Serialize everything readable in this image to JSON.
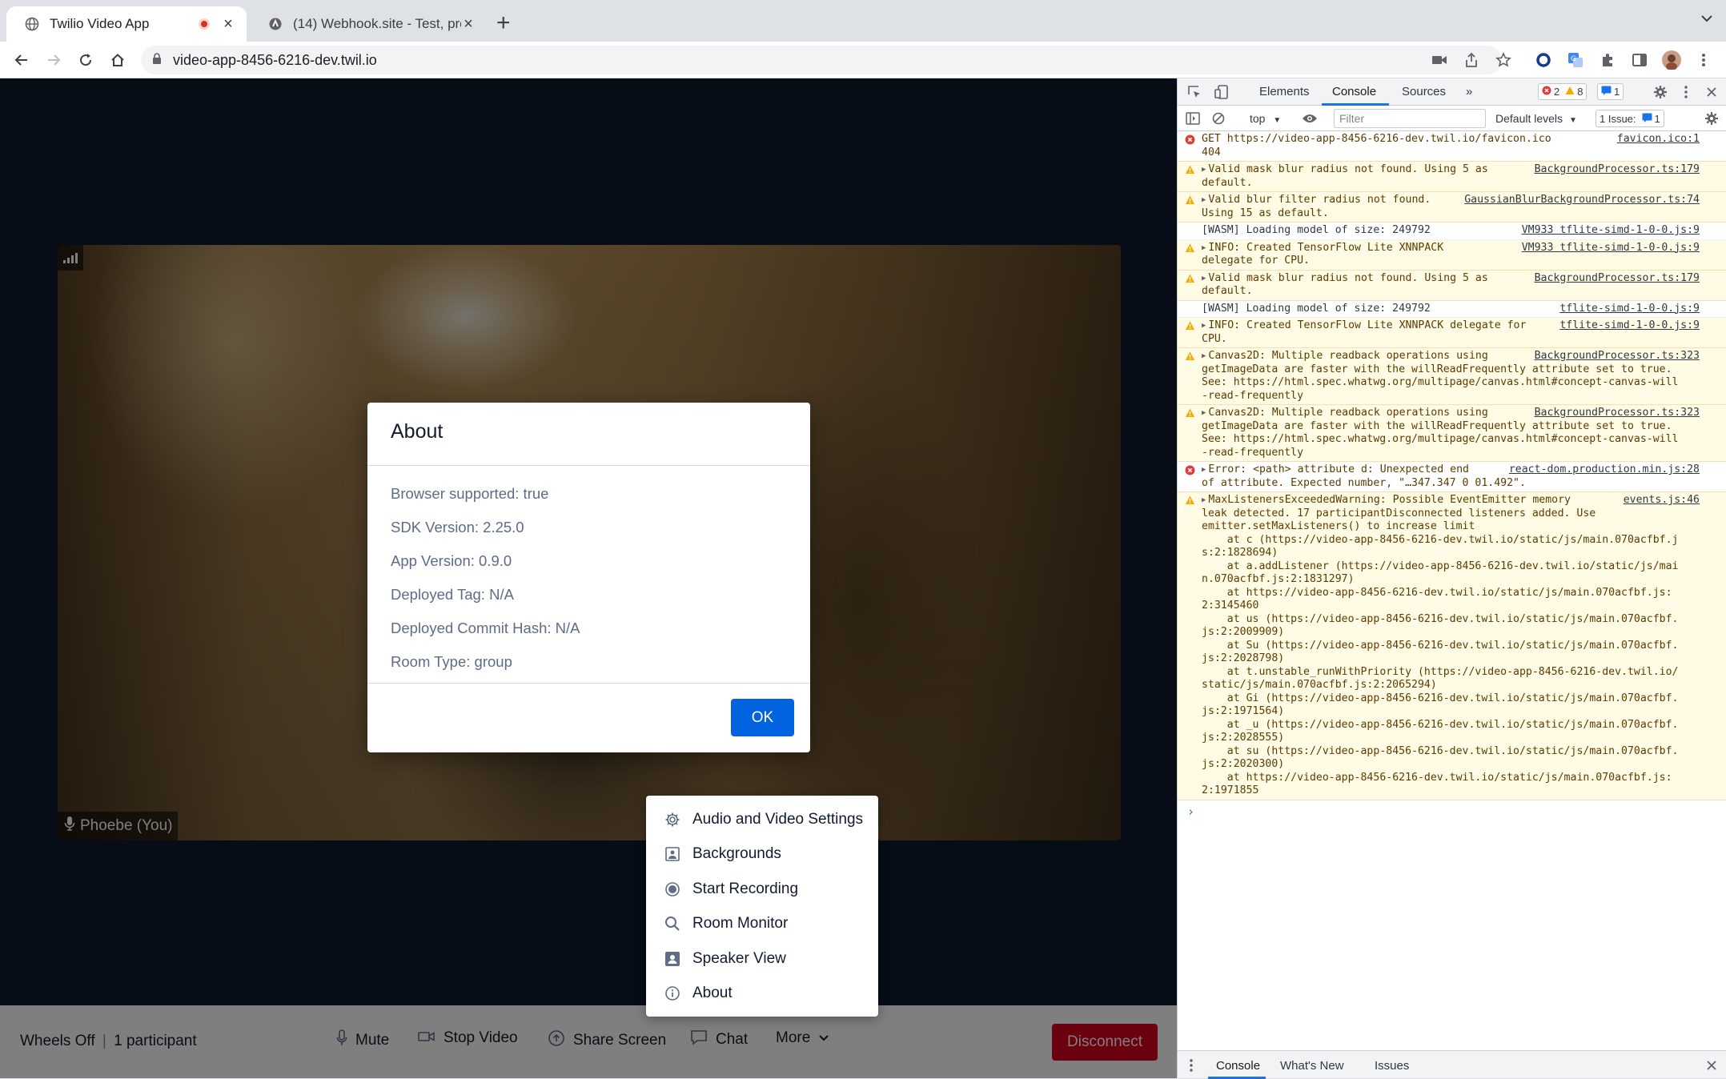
{
  "browser": {
    "tabs": [
      {
        "title": "Twilio Video App",
        "active": true,
        "recording": true
      },
      {
        "title": "(14) Webhook.site - Test, proc",
        "active": false
      }
    ],
    "url": "video-app-8456-6216-dev.twil.io"
  },
  "video": {
    "participant_label": "Phoebe (You)"
  },
  "menu_bar": {
    "room_name": "Wheels Off",
    "participant_count": "1 participant",
    "mute": "Mute",
    "stop_video": "Stop Video",
    "share_screen": "Share Screen",
    "chat": "Chat",
    "more": "More",
    "disconnect": "Disconnect",
    "disconnect_color": "#d6001c"
  },
  "more_menu": {
    "items": [
      {
        "label": "Audio and Video Settings",
        "icon": "gear-icon"
      },
      {
        "label": "Backgrounds",
        "icon": "image-icon"
      },
      {
        "label": "Start Recording",
        "icon": "record-icon"
      },
      {
        "label": "Room Monitor",
        "icon": "search-icon"
      },
      {
        "label": "Speaker View",
        "icon": "person-icon"
      },
      {
        "label": "About",
        "icon": "info-icon"
      }
    ]
  },
  "about_dialog": {
    "title": "About",
    "lines": [
      "Browser supported: true",
      "SDK Version: 2.25.0",
      "App Version: 0.9.0",
      "Deployed Tag: N/A",
      "Deployed Commit Hash: N/A",
      "Room Type: group"
    ],
    "ok": "OK",
    "ok_color": "#0263e0"
  },
  "devtools": {
    "tabs": [
      "Elements",
      "Console",
      "Sources"
    ],
    "active_tab": "Console",
    "error_count": "2",
    "warning_count": "8",
    "message_count": "1",
    "context": "top",
    "filter_placeholder": "Filter",
    "levels": "Default levels",
    "issues_label": "1 Issue:",
    "issues_count": "1",
    "drawer_tabs": [
      "Console",
      "What's New",
      "Issues"
    ],
    "console": [
      {
        "level": "error",
        "text": "GET https://video-app-8456-6216-dev.twil.io/favicon.ico\n404",
        "source": "favicon.ico:1"
      },
      {
        "level": "warn",
        "text": "Valid mask blur radius not found. Using 5 as\ndefault.",
        "source": "BackgroundProcessor.ts:179",
        "expand": true
      },
      {
        "level": "warn",
        "text": "Valid blur filter radius not found.\nUsing 15 as default.",
        "source": "GaussianBlurBackgroundProcessor.ts:74",
        "expand": true
      },
      {
        "level": "info",
        "text": "[WASM] Loading model of size: 249792",
        "source": "VM933 tflite-simd-1-0-0.js:9"
      },
      {
        "level": "warn",
        "text": "INFO: Created TensorFlow Lite XNNPACK\ndelegate for CPU.",
        "source": "VM933 tflite-simd-1-0-0.js:9",
        "expand": true
      },
      {
        "level": "warn",
        "text": "Valid mask blur radius not found. Using 5 as\ndefault.",
        "source": "BackgroundProcessor.ts:179",
        "expand": true
      },
      {
        "level": "info",
        "text": "[WASM] Loading model of size: 249792",
        "source": "tflite-simd-1-0-0.js:9"
      },
      {
        "level": "warn",
        "text": "INFO: Created TensorFlow Lite XNNPACK delegate for\nCPU.",
        "source": "tflite-simd-1-0-0.js:9",
        "expand": true
      },
      {
        "level": "warn",
        "text": "Canvas2D: Multiple readback operations using\ngetImageData are faster with the willReadFrequently attribute set to true.\nSee: https://html.spec.whatwg.org/multipage/canvas.html#concept-canvas-will\n-read-frequently",
        "source": "BackgroundProcessor.ts:323",
        "expand": true
      },
      {
        "level": "warn",
        "text": "Canvas2D: Multiple readback operations using\ngetImageData are faster with the willReadFrequently attribute set to true.\nSee: https://html.spec.whatwg.org/multipage/canvas.html#concept-canvas-will\n-read-frequently",
        "source": "BackgroundProcessor.ts:323",
        "expand": true
      },
      {
        "level": "error",
        "text": "Error: <path> attribute d: Unexpected end\nof attribute. Expected number, \"…347.347 0 01.492\".",
        "source": "react-dom.production.min.js:28",
        "expand": true
      },
      {
        "level": "warn",
        "text": "MaxListenersExceededWarning: Possible EventEmitter memory\nleak detected. 17 participantDisconnected listeners added. Use\nemitter.setMaxListeners() to increase limit\n    at c (https://video-app-8456-6216-dev.twil.io/static/js/main.070acfbf.j\ns:2:1828694)\n    at a.addListener (https://video-app-8456-6216-dev.twil.io/static/js/mai\nn.070acfbf.js:2:1831297)\n    at https://video-app-8456-6216-dev.twil.io/static/js/main.070acfbf.js:\n2:3145460\n    at us (https://video-app-8456-6216-dev.twil.io/static/js/main.070acfbf.\njs:2:2009909)\n    at Su (https://video-app-8456-6216-dev.twil.io/static/js/main.070acfbf.\njs:2:2028798)\n    at t.unstable_runWithPriority (https://video-app-8456-6216-dev.twil.io/\nstatic/js/main.070acfbf.js:2:2065294)\n    at Gi (https://video-app-8456-6216-dev.twil.io/static/js/main.070acfbf.\njs:2:1971564)\n    at _u (https://video-app-8456-6216-dev.twil.io/static/js/main.070acfbf.\njs:2:2028555)\n    at su (https://video-app-8456-6216-dev.twil.io/static/js/main.070acfbf.\njs:2:2020300)\n    at https://video-app-8456-6216-dev.twil.io/static/js/main.070acfbf.js:\n2:1971855",
        "source": "events.js:46",
        "expand": true
      }
    ]
  }
}
